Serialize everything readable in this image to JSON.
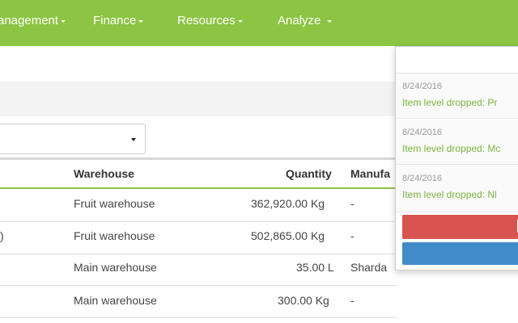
{
  "nav": {
    "items": [
      {
        "label": "anagement"
      },
      {
        "label": "Finance"
      },
      {
        "label": "Resources"
      },
      {
        "label": "Analyze"
      }
    ]
  },
  "table": {
    "headers": [
      "Warehouse",
      "Quantity",
      "Manufa"
    ],
    "rows": [
      {
        "prefix": "",
        "warehouse": "Fruit warehouse",
        "quantity": "362,920.00 Kg",
        "manufacturer": "-"
      },
      {
        "prefix": ")",
        "warehouse": "Fruit warehouse",
        "quantity": "502,865.00 Kg",
        "manufacturer": "-"
      },
      {
        "prefix": "",
        "warehouse": "Main warehouse",
        "quantity": "35.00 L",
        "manufacturer": "Sharda"
      },
      {
        "prefix": "",
        "warehouse": "Main warehouse",
        "quantity": "300.00 Kg",
        "manufacturer": "-"
      }
    ]
  },
  "notifications": [
    {
      "date": "8/24/2016",
      "text": "Item level dropped: Pr"
    },
    {
      "date": "8/24/2016",
      "text": "Item level dropped: Mc"
    },
    {
      "date": "8/24/2016",
      "text": "Item level dropped: Nl"
    }
  ],
  "colors": {
    "nav_bg": "#8cc443",
    "accent_green": "#79b43c",
    "danger": "#d9534f",
    "primary": "#428bca"
  }
}
